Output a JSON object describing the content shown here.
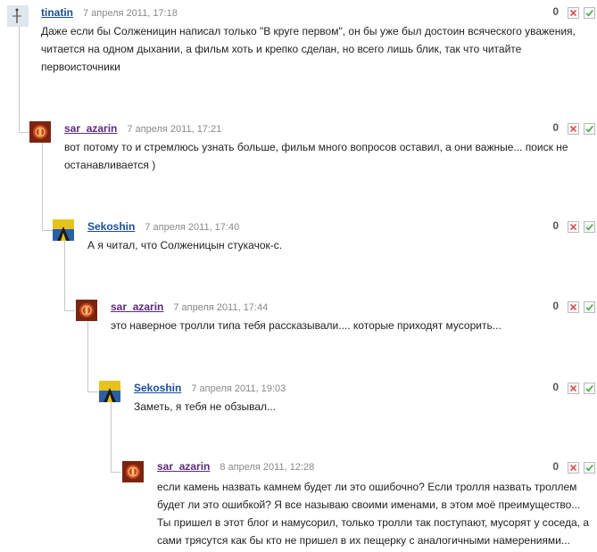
{
  "comments": [
    {
      "author": "tinatin",
      "date": "7 апреля 2011, 17:18",
      "score": "0",
      "text": [
        "Даже если бы Солженицин написал только \"В круге первом\", он бы уже был достоин всяческого уважения,",
        "читается на одном дыхании, а фильм хоть и крепко сделан, но всего лишь блик, так что читайте",
        "первоисточники"
      ]
    },
    {
      "author": "sar_azarin",
      "date": "7 апреля 2011, 17:21",
      "score": "0",
      "text": [
        "вот потому то и стремлюсь узнать больше, фильм много вопросов оставил, а они важные... поиск не",
        "останавливается )"
      ]
    },
    {
      "author": "Sekoshin",
      "date": "7 апреля 2011, 17:40",
      "score": "0",
      "text": [
        "А я читал, что Солженицын стукачок-с."
      ]
    },
    {
      "author": "sar_azarin",
      "date": "7 апреля 2011, 17:44",
      "score": "0",
      "text": [
        "это наверное тролли типа тебя рассказывали.... которые приходят мусорить..."
      ]
    },
    {
      "author": "Sekoshin",
      "date": "7 апреля 2011, 19:03",
      "score": "0",
      "text": [
        "Заметь, я тебя не обзывал..."
      ]
    },
    {
      "author": "sar_azarin",
      "date": "8 апреля 2011, 12:28",
      "score": "0",
      "text": [
        "если камень назвать камнем будет ли это ошибочно? Если тролля назвать троллем",
        "будет ли это ошибкой? Я все называю своими именами, в этом моё преимущество...",
        "Ты пришел в этот блог и намусорил, только тролли так поступают, мусорят у соседа, а",
        "сами трясутся как бы кто не пришел в их пещерку с аналогичными намерениями..."
      ]
    }
  ],
  "colors": {
    "author_blue": "#1a4f9c",
    "author_purple": "#5c2a7e",
    "vote_down": "#d9534f",
    "vote_up": "#4cae4c"
  }
}
